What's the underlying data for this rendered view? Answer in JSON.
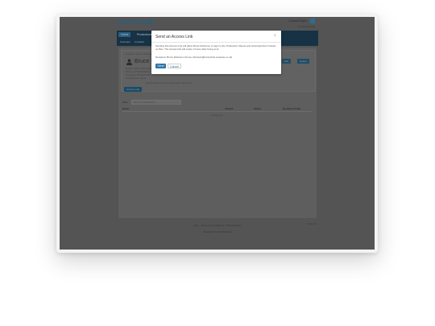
{
  "header": {
    "logo_text": "bontech",
    "logo_suffix": "uk",
    "user_name": "Cordula Taylor",
    "user_link": "Account settings"
  },
  "nav": {
    "tabs": [
      "Home",
      "Productions",
      "Directory"
    ],
    "subtabs": [
      "Overview",
      "Contacts"
    ]
  },
  "card": {
    "breadcrumb": "Contacts › Bruce Robinson",
    "name": "Bruce Robinson",
    "lines": [
      "Email: bruce.robinson@example.co.uk",
      "Phone: 07700 900123",
      "Company: Bontech UK",
      "Last access: Never"
    ],
    "note": "Access links expire 3 hours after being sent.",
    "buttons": [
      "Edit",
      "Delete"
    ],
    "action_button": "Access Link"
  },
  "table": {
    "filter_label": "Filter",
    "filter_placeholder": "Search productions...",
    "columns": [
      "Name",
      "Viewed",
      "Status",
      "Booking Profile"
    ],
    "loading_text": "Loading list..."
  },
  "footer": {
    "links": "Help  ·  Terms and Conditions  ·  Privacy Policy",
    "copyright": "Copyright © 2016 Bontech",
    "right_text": "Version 2.4"
  },
  "modal": {
    "title": "Send an Access Link",
    "close_glyph": "×",
    "body": "Sending this Access Link will allow Bruce Robinson to login to the Production Sheets and download their booked up files. The Access link will expire 3 hours after being sent.",
    "recipient": "Recipient: Bruce Robinson (bruce.robinson@bontechuk.example.co.uk)",
    "send_label": "Send",
    "cancel_label": "Cancel"
  }
}
